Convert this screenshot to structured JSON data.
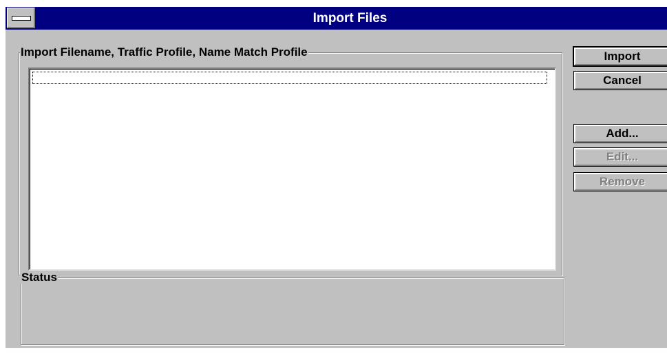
{
  "window": {
    "title": "Import Files"
  },
  "import_group": {
    "label": "Import Filename, Traffic Profile, Name Match Profile",
    "items": []
  },
  "status_group": {
    "label": "Status",
    "text": ""
  },
  "buttons": {
    "import": "Import",
    "cancel": "Cancel",
    "add": "Add...",
    "edit": "Edit...",
    "remove": "Remove"
  },
  "button_states": {
    "edit_enabled": false,
    "remove_enabled": false
  },
  "colors": {
    "titlebar": "#000080",
    "face": "#c0c0c0",
    "disabled_text": "#808080"
  },
  "icons": {
    "system_menu": "system-menu-icon"
  }
}
